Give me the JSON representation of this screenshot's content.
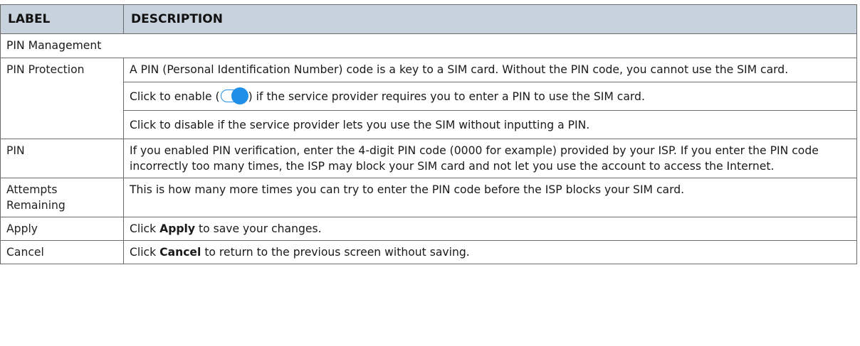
{
  "header": {
    "label": "LABEL",
    "description": "DESCRIPTION"
  },
  "section_title": "PIN Management",
  "rows": [
    {
      "label": "PIN Protection",
      "desc1": "A PIN (Personal Identification Number) code is a key to a SIM card. Without the PIN code, you cannot use the SIM card.",
      "desc2_before": "Click to enable (",
      "desc2_after": ") if the service provider requires you to enter a PIN to use the SIM card.",
      "desc3": "Click to disable if the service provider lets you use the SIM without inputting a PIN."
    },
    {
      "label": "PIN",
      "desc": "If you enabled PIN verification, enter the 4-digit PIN code (0000 for example) provided by your ISP. If you enter the PIN code incorrectly too many times, the ISP may block your SIM card and not let you use the account to access the Internet."
    },
    {
      "label": "Attempts Remaining",
      "desc": "This is how many more times you can try to enter the PIN code before the ISP blocks your SIM card."
    },
    {
      "label": "Apply",
      "pre": "Click ",
      "bold": "Apply",
      "post": " to save your changes."
    },
    {
      "label": "Cancel",
      "pre": "Click ",
      "bold": "Cancel",
      "post": " to return to the previous screen without saving."
    }
  ],
  "icons": {
    "toggle": "toggle-on-icon"
  },
  "colors": {
    "header_bg": "#c7d2dd",
    "accent": "#1f8fe8",
    "border": "#6b6b6b"
  }
}
